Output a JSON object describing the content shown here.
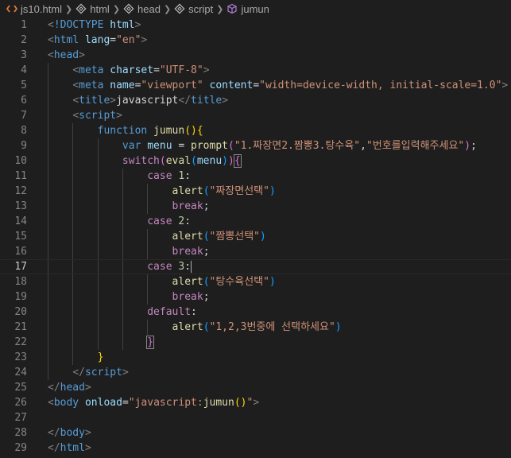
{
  "breadcrumb": [
    {
      "label": "js10.html",
      "icon": "html-file-icon"
    },
    {
      "label": "html",
      "icon": "element-icon"
    },
    {
      "label": "head",
      "icon": "element-icon"
    },
    {
      "label": "script",
      "icon": "element-icon"
    },
    {
      "label": "jumun",
      "icon": "function-cube-icon"
    }
  ],
  "editor": {
    "active_line": 17,
    "lines": [
      {
        "n": "1",
        "indent": 0,
        "tokens": [
          [
            "t-br",
            "<"
          ],
          [
            "t-tag",
            "!DOCTYPE"
          ],
          [
            "t-text",
            " "
          ],
          [
            "t-attr",
            "html"
          ],
          [
            "t-br",
            ">"
          ]
        ]
      },
      {
        "n": "2",
        "indent": 0,
        "tokens": [
          [
            "t-br",
            "<"
          ],
          [
            "t-tag",
            "html"
          ],
          [
            "t-text",
            " "
          ],
          [
            "t-attr",
            "lang"
          ],
          [
            "t-text",
            "="
          ],
          [
            "t-str",
            "\"en\""
          ],
          [
            "t-br",
            ">"
          ]
        ]
      },
      {
        "n": "3",
        "indent": 0,
        "tokens": [
          [
            "t-br",
            "<"
          ],
          [
            "t-tag",
            "head"
          ],
          [
            "t-br",
            ">"
          ]
        ]
      },
      {
        "n": "4",
        "indent": 1,
        "tokens": [
          [
            "t-br",
            "<"
          ],
          [
            "t-tag",
            "meta"
          ],
          [
            "t-text",
            " "
          ],
          [
            "t-attr",
            "charset"
          ],
          [
            "t-text",
            "="
          ],
          [
            "t-str",
            "\"UTF-8\""
          ],
          [
            "t-br",
            ">"
          ]
        ]
      },
      {
        "n": "5",
        "indent": 1,
        "tokens": [
          [
            "t-br",
            "<"
          ],
          [
            "t-tag",
            "meta"
          ],
          [
            "t-text",
            " "
          ],
          [
            "t-attr",
            "name"
          ],
          [
            "t-text",
            "="
          ],
          [
            "t-str",
            "\"viewport\""
          ],
          [
            "t-text",
            " "
          ],
          [
            "t-attr",
            "content"
          ],
          [
            "t-text",
            "="
          ],
          [
            "t-str",
            "\"width=device-width, initial-scale=1.0\""
          ],
          [
            "t-br",
            ">"
          ]
        ]
      },
      {
        "n": "6",
        "indent": 1,
        "tokens": [
          [
            "t-br",
            "<"
          ],
          [
            "t-tag",
            "title"
          ],
          [
            "t-br",
            ">"
          ],
          [
            "t-text",
            "javascript"
          ],
          [
            "t-br",
            "</"
          ],
          [
            "t-tag",
            "title"
          ],
          [
            "t-br",
            ">"
          ]
        ]
      },
      {
        "n": "7",
        "indent": 1,
        "tokens": [
          [
            "t-br",
            "<"
          ],
          [
            "t-tag",
            "script"
          ],
          [
            "t-br",
            ">"
          ]
        ]
      },
      {
        "n": "8",
        "indent": 2,
        "tokens": [
          [
            "t-kw",
            "function"
          ],
          [
            "t-text",
            " "
          ],
          [
            "t-fn",
            "jumun"
          ],
          [
            "t-p1",
            "()"
          ],
          [
            "t-p1",
            "{"
          ]
        ]
      },
      {
        "n": "9",
        "indent": 3,
        "tokens": [
          [
            "t-kw",
            "var"
          ],
          [
            "t-text",
            " "
          ],
          [
            "t-var",
            "menu"
          ],
          [
            "t-text",
            " = "
          ],
          [
            "t-fn",
            "prompt"
          ],
          [
            "t-p2",
            "("
          ],
          [
            "t-str",
            "\"1.짜장면2.짬뽕3.탕수육\""
          ],
          [
            "t-text",
            ","
          ],
          [
            "t-str",
            "\"번호를입력해주세요\""
          ],
          [
            "t-p2",
            ")"
          ],
          [
            "t-text",
            ";"
          ]
        ]
      },
      {
        "n": "10",
        "indent": 3,
        "tokens": [
          [
            "t-ctl",
            "switch"
          ],
          [
            "t-p2",
            "("
          ],
          [
            "t-fn",
            "eval"
          ],
          [
            "t-p3",
            "("
          ],
          [
            "t-var",
            "menu"
          ],
          [
            "t-p3",
            ")"
          ],
          [
            "t-p2",
            ")"
          ],
          [
            "t-p2 boxed",
            "{"
          ]
        ]
      },
      {
        "n": "11",
        "indent": 4,
        "tokens": [
          [
            "t-ctl",
            "case"
          ],
          [
            "t-text",
            " "
          ],
          [
            "t-num",
            "1"
          ],
          [
            "t-text",
            ":"
          ]
        ]
      },
      {
        "n": "12",
        "indent": 5,
        "tokens": [
          [
            "t-fn",
            "alert"
          ],
          [
            "t-p3",
            "("
          ],
          [
            "t-str",
            "\"짜장면선택\""
          ],
          [
            "t-p3",
            ")"
          ]
        ]
      },
      {
        "n": "13",
        "indent": 5,
        "tokens": [
          [
            "t-ctl",
            "break"
          ],
          [
            "t-text",
            ";"
          ]
        ]
      },
      {
        "n": "14",
        "indent": 4,
        "tokens": [
          [
            "t-ctl",
            "case"
          ],
          [
            "t-text",
            " "
          ],
          [
            "t-num",
            "2"
          ],
          [
            "t-text",
            ":"
          ]
        ]
      },
      {
        "n": "15",
        "indent": 5,
        "tokens": [
          [
            "t-fn",
            "alert"
          ],
          [
            "t-p3",
            "("
          ],
          [
            "t-str",
            "\"짬뽕선택\""
          ],
          [
            "t-p3",
            ")"
          ]
        ]
      },
      {
        "n": "16",
        "indent": 5,
        "tokens": [
          [
            "t-ctl",
            "break"
          ],
          [
            "t-text",
            ";"
          ]
        ]
      },
      {
        "n": "17",
        "indent": 4,
        "tokens": [
          [
            "t-ctl",
            "case"
          ],
          [
            "t-text",
            " "
          ],
          [
            "t-num",
            "3"
          ],
          [
            "t-text",
            ":"
          ]
        ],
        "cursor": true
      },
      {
        "n": "18",
        "indent": 5,
        "tokens": [
          [
            "t-fn",
            "alert"
          ],
          [
            "t-p3",
            "("
          ],
          [
            "t-str",
            "\"탕수육선택\""
          ],
          [
            "t-p3",
            ")"
          ]
        ]
      },
      {
        "n": "19",
        "indent": 5,
        "tokens": [
          [
            "t-ctl",
            "break"
          ],
          [
            "t-text",
            ";"
          ]
        ]
      },
      {
        "n": "20",
        "indent": 4,
        "tokens": [
          [
            "t-ctl",
            "default"
          ],
          [
            "t-text",
            ":"
          ]
        ]
      },
      {
        "n": "21",
        "indent": 5,
        "tokens": [
          [
            "t-fn",
            "alert"
          ],
          [
            "t-p3",
            "("
          ],
          [
            "t-str",
            "\"1,2,3번중에 선택하세요\""
          ],
          [
            "t-p3",
            ")"
          ]
        ]
      },
      {
        "n": "22",
        "indent": 4,
        "tokens": [
          [
            "t-p2 boxed",
            "}"
          ]
        ]
      },
      {
        "n": "23",
        "indent": 2,
        "tokens": [
          [
            "t-p1",
            "}"
          ]
        ]
      },
      {
        "n": "24",
        "indent": 1,
        "tokens": [
          [
            "t-br",
            "</"
          ],
          [
            "t-tag",
            "script"
          ],
          [
            "t-br",
            ">"
          ]
        ]
      },
      {
        "n": "25",
        "indent": 0,
        "tokens": [
          [
            "t-br",
            "</"
          ],
          [
            "t-tag",
            "head"
          ],
          [
            "t-br",
            ">"
          ]
        ]
      },
      {
        "n": "26",
        "indent": 0,
        "tokens": [
          [
            "t-br",
            "<"
          ],
          [
            "t-tag",
            "body"
          ],
          [
            "t-text",
            " "
          ],
          [
            "t-attr",
            "onload"
          ],
          [
            "t-text",
            "="
          ],
          [
            "t-str",
            "\"javascript:"
          ],
          [
            "t-fn",
            "jumun"
          ],
          [
            "t-p1",
            "()"
          ],
          [
            "t-str",
            "\""
          ],
          [
            "t-br",
            ">"
          ]
        ]
      },
      {
        "n": "27",
        "indent": 0,
        "tokens": []
      },
      {
        "n": "28",
        "indent": 0,
        "tokens": [
          [
            "t-br",
            "</"
          ],
          [
            "t-tag",
            "body"
          ],
          [
            "t-br",
            ">"
          ]
        ]
      },
      {
        "n": "29",
        "indent": 0,
        "tokens": [
          [
            "t-br",
            "</"
          ],
          [
            "t-tag",
            "html"
          ],
          [
            "t-br",
            ">"
          ]
        ]
      }
    ]
  }
}
